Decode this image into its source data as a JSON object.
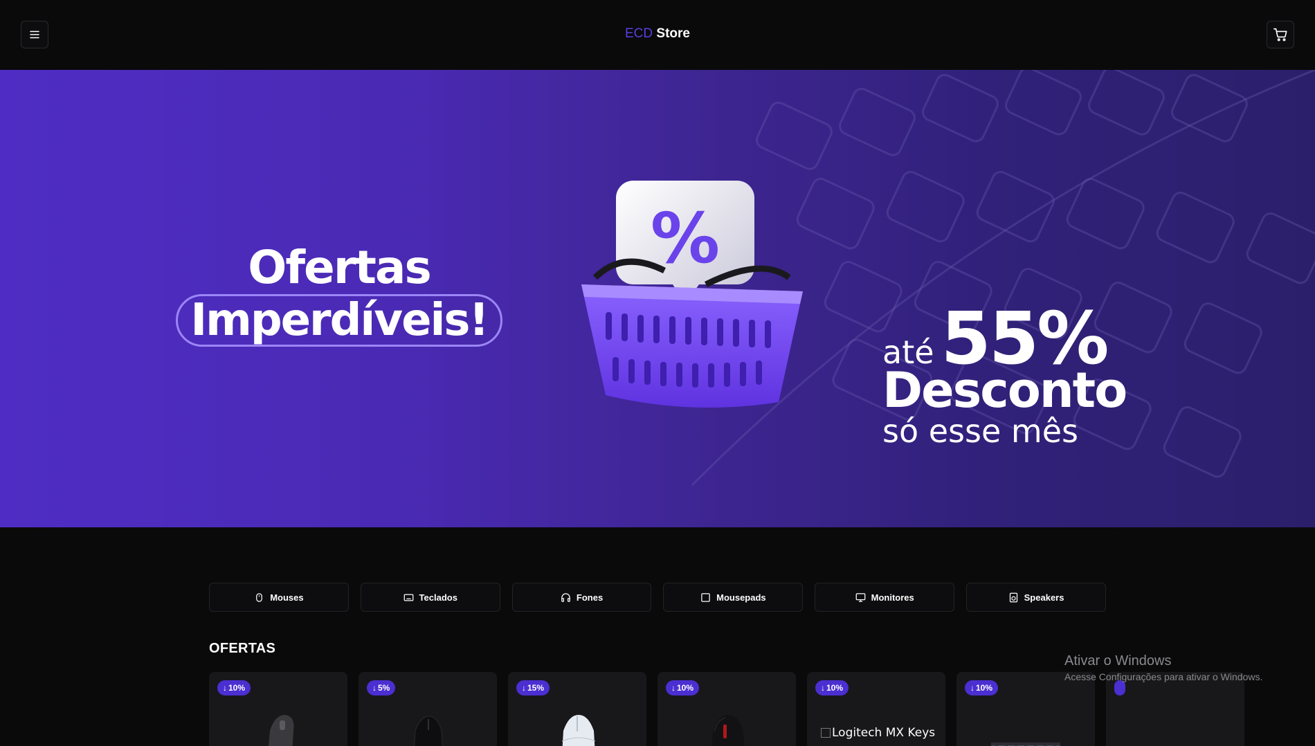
{
  "header": {
    "brand_accent": "ECD",
    "brand_rest": "Store",
    "menu_icon": "hamburger-menu-icon",
    "cart_icon": "shopping-cart-icon"
  },
  "hero": {
    "ofertas": "Ofertas",
    "imperdiveis": "Imperdíveis!",
    "ate": "até",
    "percent": "55%",
    "desconto": "Desconto",
    "so_esse_mes": "só esse mês",
    "basket_icon": "shopping-basket-percent-icon"
  },
  "categories": [
    {
      "label": "Mouses",
      "icon": "mouse-icon"
    },
    {
      "label": "Teclados",
      "icon": "keyboard-icon"
    },
    {
      "label": "Fones",
      "icon": "headphones-icon"
    },
    {
      "label": "Mousepads",
      "icon": "square-icon"
    },
    {
      "label": "Monitores",
      "icon": "monitor-icon"
    },
    {
      "label": "Speakers",
      "icon": "speaker-icon"
    }
  ],
  "section_title": "OFERTAS",
  "products": [
    {
      "discount": "10%"
    },
    {
      "discount": "5%"
    },
    {
      "discount": "15%"
    },
    {
      "discount": "10%"
    },
    {
      "discount": "10%",
      "broken_image_alt": "Logitech MX Keys"
    },
    {
      "discount": "10%"
    }
  ],
  "watermark": {
    "title": "Ativar o Windows",
    "subtitle": "Acesse Configurações para ativar o Windows."
  },
  "colors": {
    "accent": "#5b3ee0",
    "badge": "#4b2fd1",
    "background": "#0a0a0b"
  }
}
